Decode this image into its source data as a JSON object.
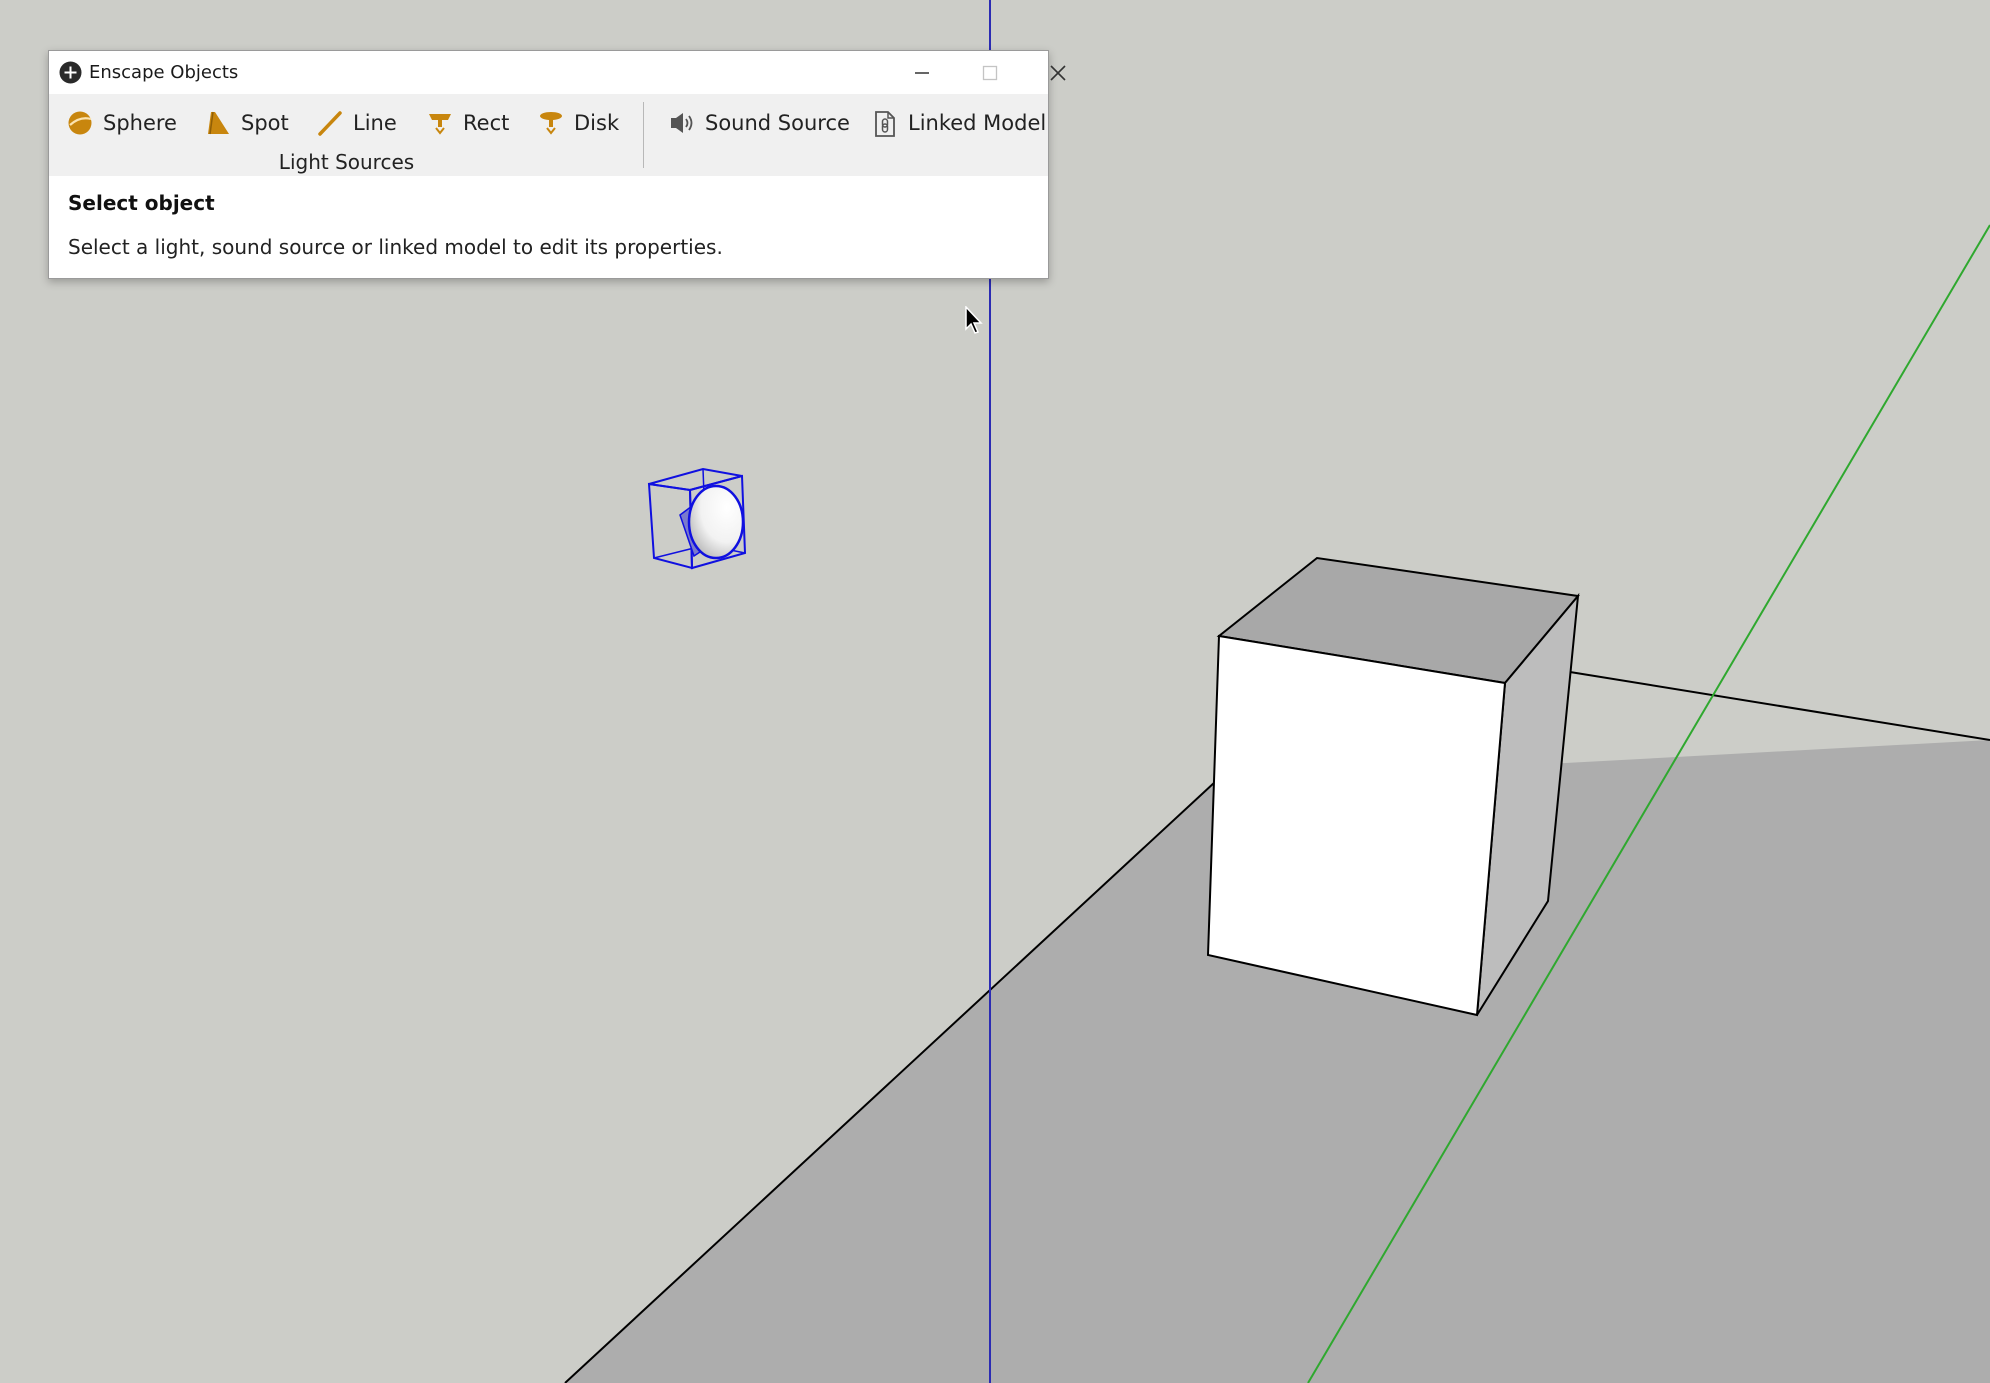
{
  "window": {
    "title": "Enscape Objects"
  },
  "ribbon": {
    "light_group_label": "Light Sources",
    "tools": {
      "sphere": "Sphere",
      "spot": "Spot",
      "line": "Line",
      "rect": "Rect",
      "disk": "Disk",
      "sound_source": "Sound Source",
      "linked_model": "Linked Model"
    }
  },
  "panel": {
    "heading": "Select object",
    "description": "Select a light, sound source or linked model to edit its properties."
  },
  "icons": {
    "app": "enscape-plus-icon",
    "minimize": "minimize-icon",
    "maximize": "maximize-icon",
    "close": "close-icon",
    "sphere": "sphere-light-icon",
    "spot": "spot-light-icon",
    "line": "line-light-icon",
    "rect": "rect-light-icon",
    "disk": "disk-light-icon",
    "sound": "speaker-icon",
    "linked": "linked-file-icon",
    "cursor": "mouse-cursor-icon"
  },
  "colors": {
    "icon_accent": "#c8860e",
    "viewport_background": "#cccdc8",
    "ground_plane": "#adadad",
    "blue_axis": "#2b2bb3",
    "green_axis": "#2fa82f",
    "selection": "#1010e0"
  }
}
